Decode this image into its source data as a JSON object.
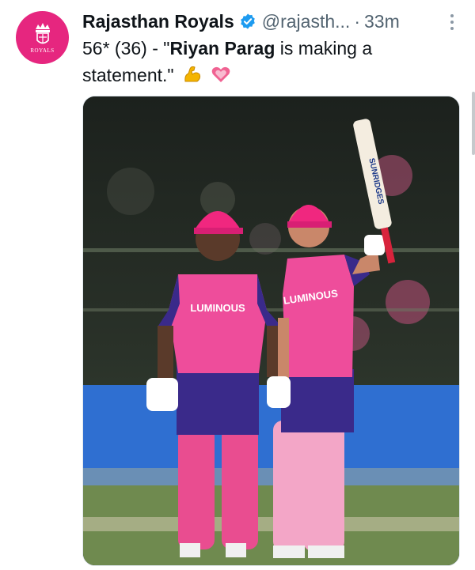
{
  "tweet": {
    "author_name": "Rajasthan Royals",
    "handle": "@rajasth...",
    "separator": "·",
    "time": "33m",
    "text_prefix": "56* (36) - \"",
    "text_bold": "Riyan Parag",
    "text_suffix": " is making a statement.\"",
    "emojis": [
      "flexed-biceps",
      "growing-heart"
    ]
  },
  "avatar": {
    "brand_text": "ROYALS",
    "color": "#e6267f"
  },
  "photo": {
    "jersey_text_left": "LUMINOUS",
    "jersey_text_right": "LUMINOUS",
    "bat_text": "SUNRIDGES",
    "jersey_color": "#ee4d9b",
    "trim_color": "#3a2a8a"
  },
  "colors": {
    "verified_blue": "#1d9bf0",
    "secondary_text": "#536471"
  }
}
